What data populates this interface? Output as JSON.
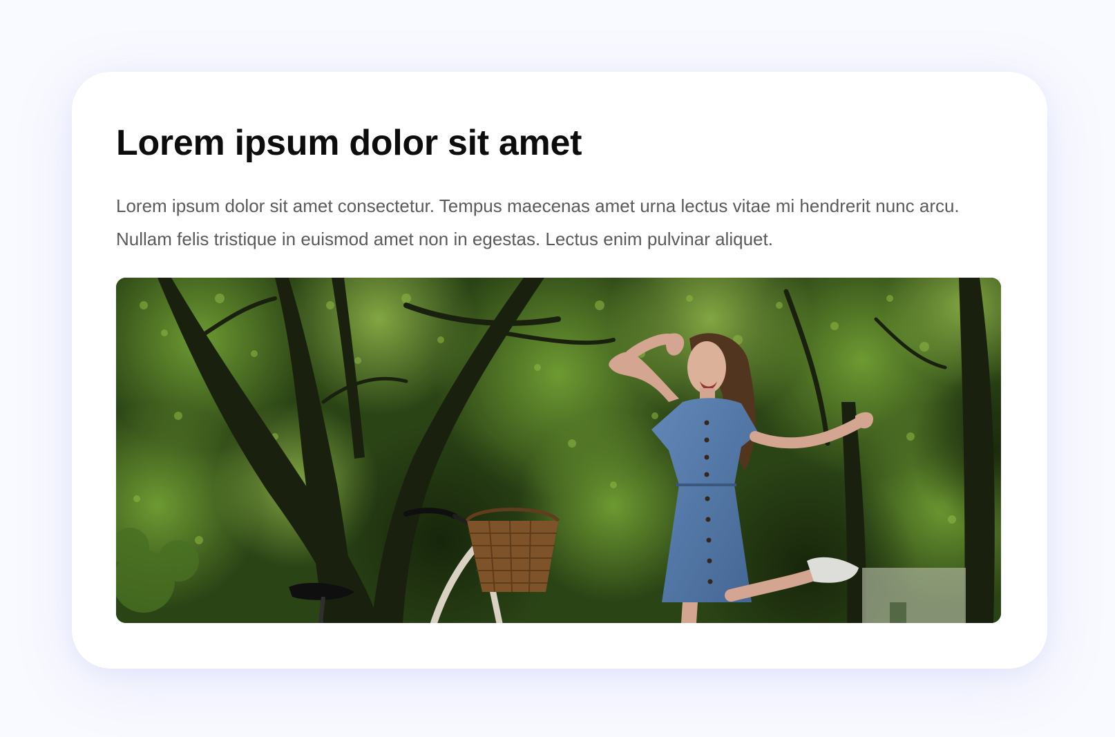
{
  "card": {
    "title": "Lorem ipsum dolor sit amet",
    "description": "Lorem ipsum dolor sit amet consectetur. Tempus maecenas amet urna lectus vitae mi hendrerit nunc arcu. Nullam felis tristique in euismod amet non in egestas. Lectus enim pulvinar aliquet."
  },
  "colors": {
    "page_background": "#f9faff",
    "card_background": "#ffffff",
    "title_text": "#0c0c0c",
    "body_text": "#5a5a5a",
    "foliage": "#3f6a1e",
    "dress": "#5b84b8"
  }
}
